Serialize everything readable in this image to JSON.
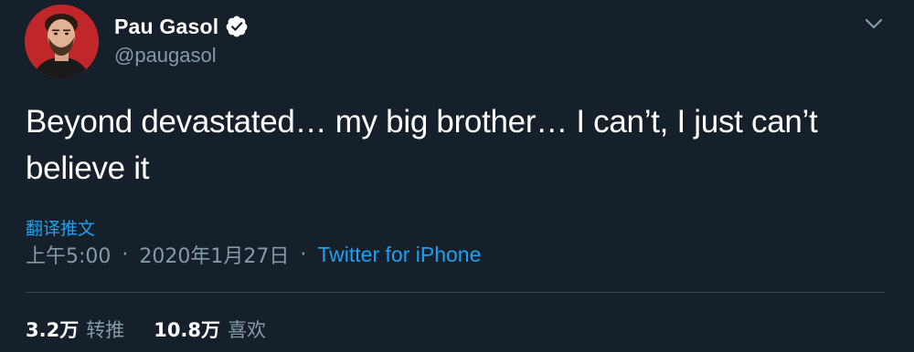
{
  "author": {
    "display_name": "Pau Gasol",
    "handle": "@paugasol"
  },
  "tweet": {
    "text": "Beyond devastated… my big brother… I can’t, I just can’t believe it",
    "translate_label": "翻译推文",
    "time": "上午5:00",
    "date": "2020年1月27日",
    "source": "Twitter for iPhone",
    "separator": "·"
  },
  "stats": {
    "retweets_count": "3.2万",
    "retweets_label": "转推",
    "likes_count": "10.8万",
    "likes_label": "喜欢"
  },
  "colors": {
    "background": "#15202b",
    "accent": "#1da1f2",
    "secondary_text": "#8899a6",
    "avatar_bg": "#c0262a"
  },
  "icons": {
    "verified": "verified-badge-icon",
    "menu": "chevron-down-icon"
  }
}
